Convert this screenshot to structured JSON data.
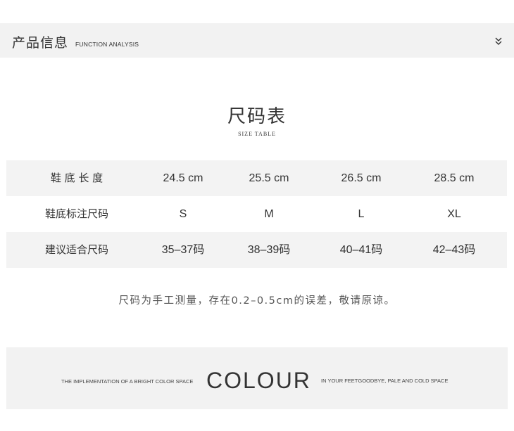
{
  "header": {
    "title": "产品信息",
    "subtitle": "FUNCTION ANALYSIS",
    "toggle_icon": "double-chevron-down-icon"
  },
  "size_table": {
    "title": "尺码表",
    "subtitle": "SIZE TABLE",
    "rows": [
      {
        "label": "鞋 底 长 度",
        "values": [
          "24.5 cm",
          "25.5 cm",
          "26.5 cm",
          "28.5 cm"
        ]
      },
      {
        "label": "鞋底标注尺码",
        "values": [
          "S",
          "M",
          "L",
          "XL"
        ]
      },
      {
        "label": "建议适合尺码",
        "values": [
          "35–37码",
          "38–39码",
          "40–41码",
          "42–43码"
        ]
      }
    ]
  },
  "note": "尺码为手工测量，存在0.2–0.5cm的误差，敬请原谅。",
  "banner": {
    "left_text": "THE IMPLEMENTATION OF A BRIGHT COLOR SPACE",
    "main_text": "COLOUR",
    "right_text": "IN YOUR FEETGOODBYE, PALE AND COLD SPACE"
  }
}
